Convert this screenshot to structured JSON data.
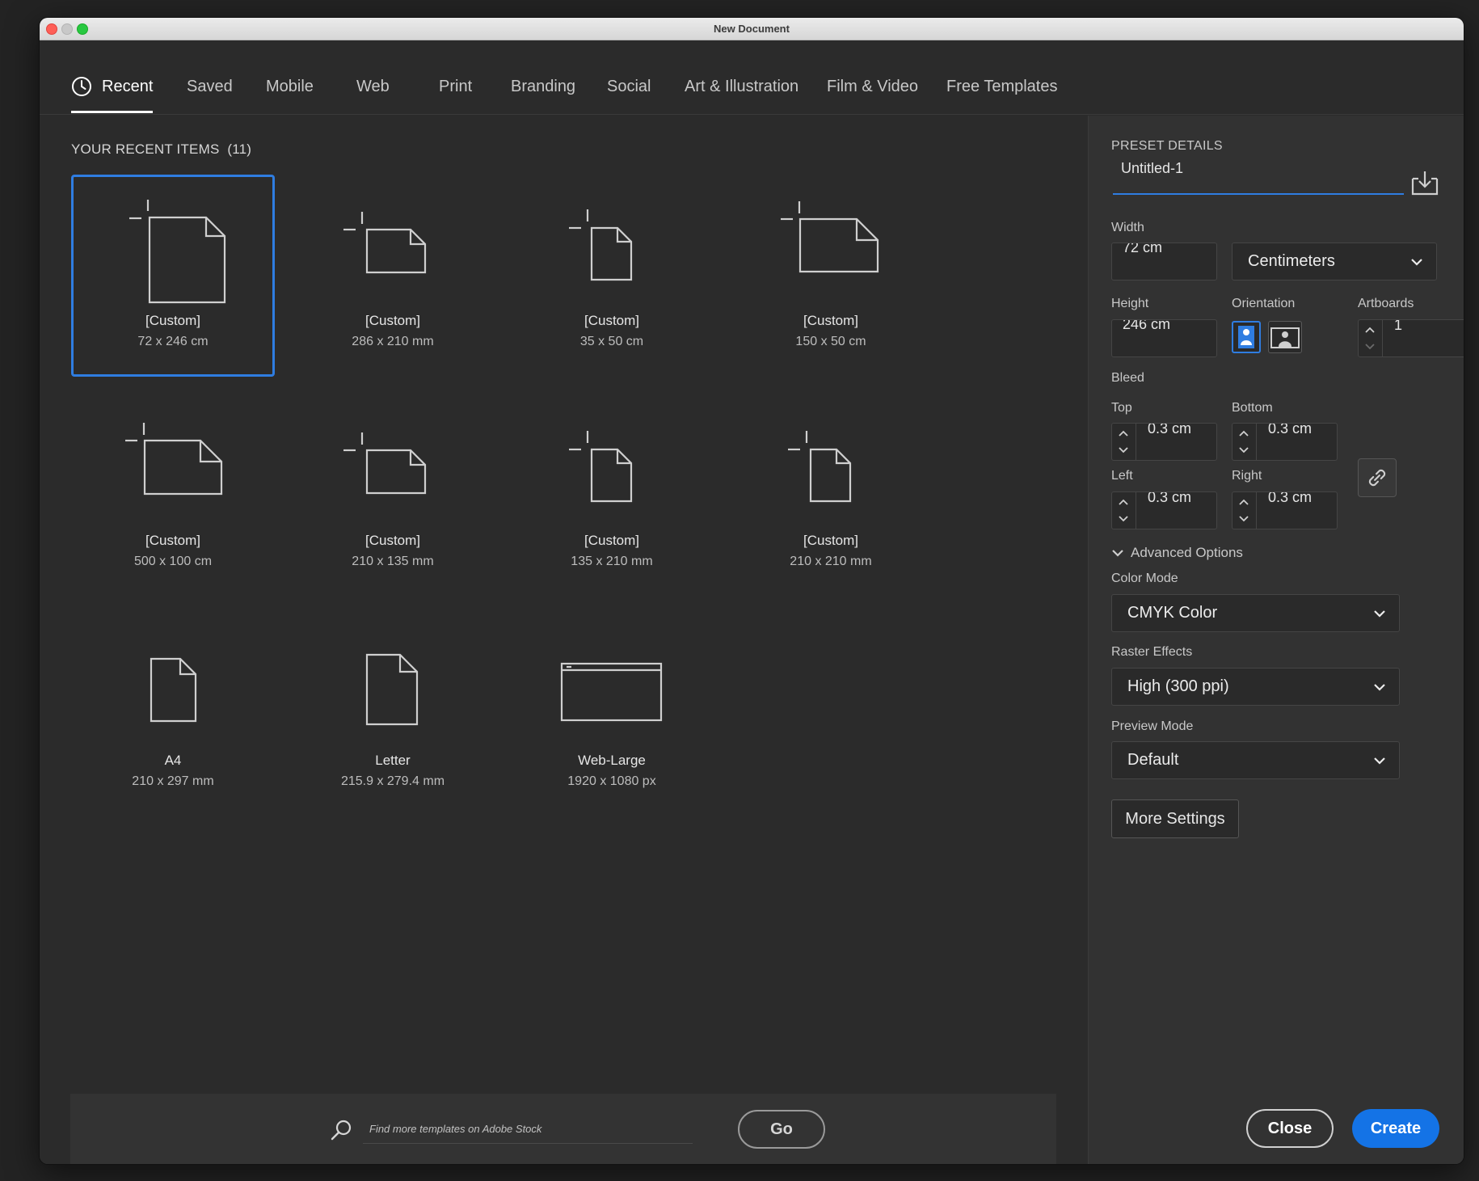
{
  "window": {
    "title": "New Document"
  },
  "tabs": [
    {
      "label": "Recent"
    },
    {
      "label": "Saved"
    },
    {
      "label": "Mobile"
    },
    {
      "label": "Web"
    },
    {
      "label": "Print"
    },
    {
      "label": "Branding"
    },
    {
      "label": "Social"
    },
    {
      "label": "Art & Illustration"
    },
    {
      "label": "Film & Video"
    },
    {
      "label": "Free Templates"
    }
  ],
  "recent": {
    "title": "YOUR RECENT ITEMS",
    "count": "(11)",
    "items": [
      {
        "name": "[Custom]",
        "size": "72 x 246 cm",
        "icon": "custom-portrait-document-icon"
      },
      {
        "name": "[Custom]",
        "size": "286 x 210 mm",
        "icon": "custom-landscape-document-icon"
      },
      {
        "name": "[Custom]",
        "size": "35 x 50 cm",
        "icon": "custom-portrait-document-icon"
      },
      {
        "name": "[Custom]",
        "size": "150 x 50 cm",
        "icon": "custom-landscape-document-icon"
      },
      {
        "name": "[Custom]",
        "size": "500 x 100 cm",
        "icon": "custom-landscape-document-icon"
      },
      {
        "name": "[Custom]",
        "size": "210 x 135 mm",
        "icon": "custom-landscape-document-icon"
      },
      {
        "name": "[Custom]",
        "size": "135 x 210 mm",
        "icon": "custom-portrait-document-icon"
      },
      {
        "name": "[Custom]",
        "size": "210 x 210 mm",
        "icon": "custom-portrait-document-icon"
      },
      {
        "name": "A4",
        "size": "210 x 297 mm",
        "icon": "document-icon"
      },
      {
        "name": "Letter",
        "size": "215.9 x 279.4 mm",
        "icon": "document-icon"
      },
      {
        "name": "Web-Large",
        "size": "1920 x 1080 px",
        "icon": "browser-window-icon"
      }
    ]
  },
  "search": {
    "placeholder": "Find more templates on Adobe Stock",
    "go_label": "Go"
  },
  "preset": {
    "heading": "PRESET DETAILS",
    "name": "Untitled-1",
    "width_label": "Width",
    "width": "72 cm",
    "units": "Centimeters",
    "height_label": "Height",
    "height": "246 cm",
    "orientation_label": "Orientation",
    "orientation": "portrait",
    "artboards_label": "Artboards",
    "artboards": "1",
    "bleed_label": "Bleed",
    "top_label": "Top",
    "top": "0.3 cm",
    "bottom_label": "Bottom",
    "bottom": "0.3 cm",
    "left_label": "Left",
    "left": "0.3 cm",
    "right_label": "Right",
    "right": "0.3 cm",
    "advanced_label": "Advanced Options",
    "color_mode_label": "Color Mode",
    "color_mode": "CMYK Color",
    "raster_label": "Raster Effects",
    "raster": "High (300 ppi)",
    "preview_label": "Preview Mode",
    "preview": "Default",
    "more_settings": "More Settings",
    "close": "Close",
    "create": "Create"
  },
  "colors": {
    "accent": "#2f7de1",
    "create": "#1473e6"
  }
}
